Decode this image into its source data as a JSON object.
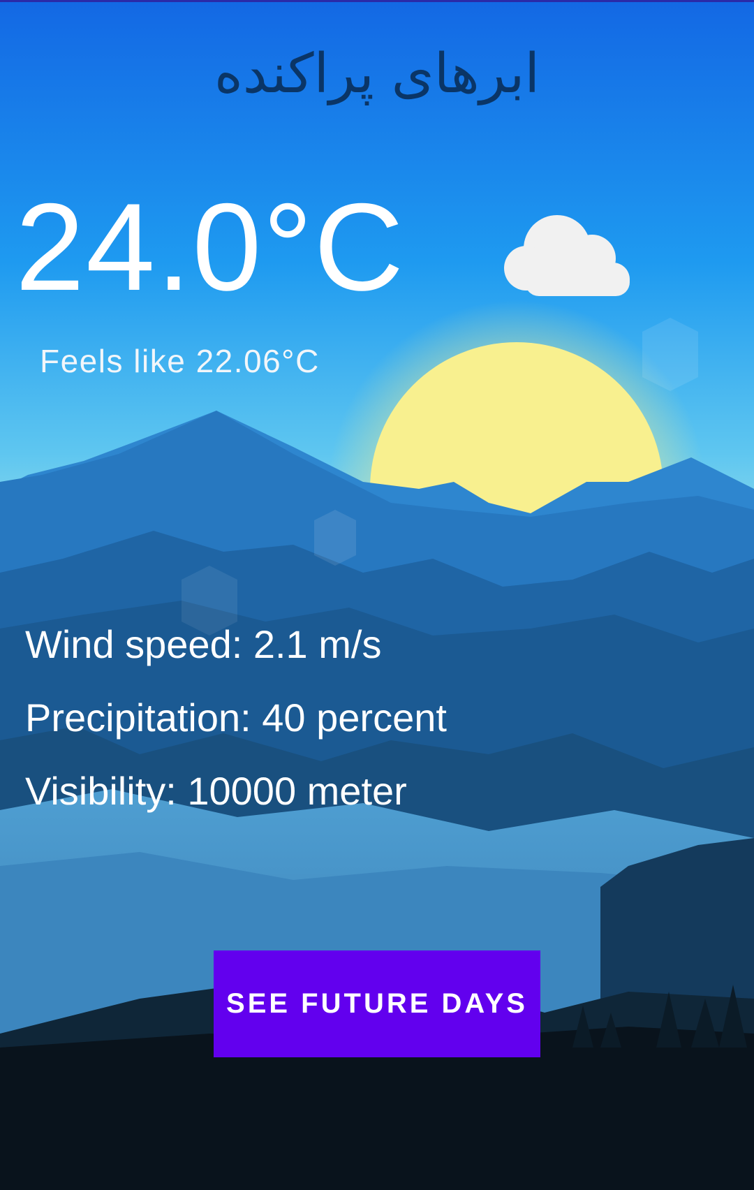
{
  "weather": {
    "description": "ابرهای پراکنده",
    "temperature": "24.0°C",
    "feels_like": "Feels like 22.06°C",
    "condition_icon": "cloud-icon",
    "wind_speed": "Wind speed: 2.1 m/s",
    "precipitation": "Precipitation: 40 percent",
    "visibility": "Visibility: 10000 meter"
  },
  "actions": {
    "future_days_label": "SEE FUTURE DAYS"
  },
  "colors": {
    "accent": "#6200ee",
    "sky_top": "#1473e6",
    "sun": "#fbf08c",
    "description_text": "#0a3566"
  }
}
